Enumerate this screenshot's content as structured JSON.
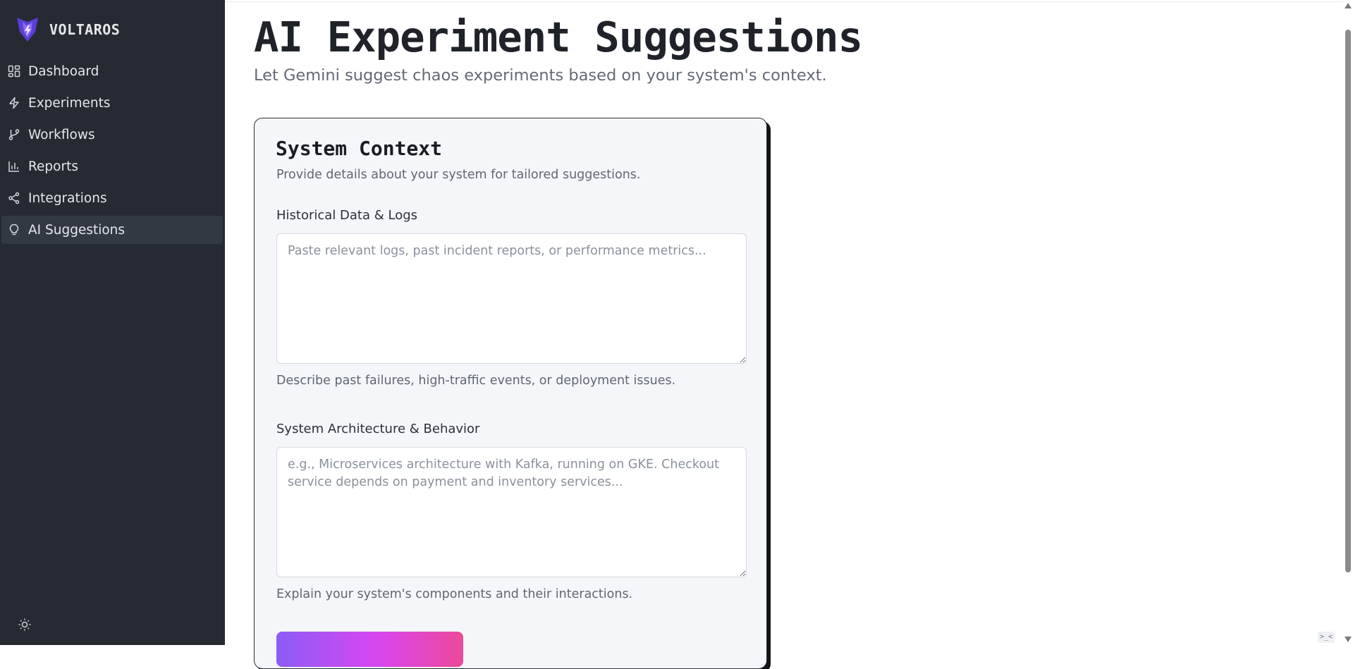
{
  "brand": {
    "name": "VOLTAROS",
    "logo_icon": "voltaros-logo-icon",
    "accent": "#7c4dff"
  },
  "sidebar": {
    "items": [
      {
        "label": "Dashboard",
        "icon": "dashboard-grid-icon",
        "active": false
      },
      {
        "label": "Experiments",
        "icon": "zap-icon",
        "active": false
      },
      {
        "label": "Workflows",
        "icon": "git-branch-icon",
        "active": false
      },
      {
        "label": "Reports",
        "icon": "bar-chart-icon",
        "active": false
      },
      {
        "label": "Integrations",
        "icon": "share-icon",
        "active": false
      },
      {
        "label": "AI Suggestions",
        "icon": "lightbulb-icon",
        "active": true
      }
    ],
    "theme_toggle_icon": "sun-icon"
  },
  "page": {
    "title": "AI Experiment Suggestions",
    "subtitle": "Let Gemini suggest chaos experiments based on your system's context."
  },
  "card": {
    "title": "System Context",
    "description": "Provide details about your system for tailored suggestions.",
    "fields": [
      {
        "label": "Historical Data & Logs",
        "value": "",
        "placeholder": "Paste relevant logs, past incident reports, or performance metrics...",
        "help": "Describe past failures, high-traffic events, or deployment issues."
      },
      {
        "label": "System Architecture & Behavior",
        "value": "",
        "placeholder": "e.g., Microservices architecture with Kafka, running on GKE. Checkout service depends on payment and inventory services...",
        "help": "Explain your system's components and their interactions."
      }
    ],
    "button_gradient": [
      "#8b5cf6",
      "#d946ef",
      "#ec4899"
    ]
  },
  "colors": {
    "sidebar_bg": "#262b33",
    "sidebar_active_bg": "#323943",
    "card_bg": "#f5f6f9"
  }
}
